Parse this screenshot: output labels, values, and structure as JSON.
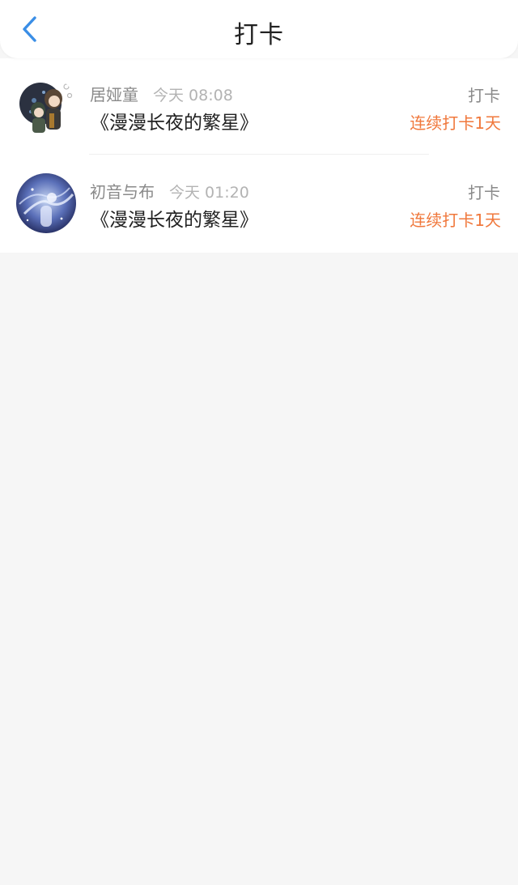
{
  "header": {
    "title": "打卡",
    "back_icon": "chevron-left-icon",
    "accent_color": "#3a8ee6"
  },
  "checkins": [
    {
      "user": "居娅童",
      "time": "今天 08:08",
      "book": "《漫漫长夜的繁星》",
      "action": "打卡",
      "streak": "连续打卡1天"
    },
    {
      "user": "初音与布",
      "time": "今天 01:20",
      "book": "《漫漫长夜的繁星》",
      "action": "打卡",
      "streak": "连续打卡1天"
    }
  ],
  "colors": {
    "streak": "#f0783c",
    "background": "#f6f6f6"
  }
}
